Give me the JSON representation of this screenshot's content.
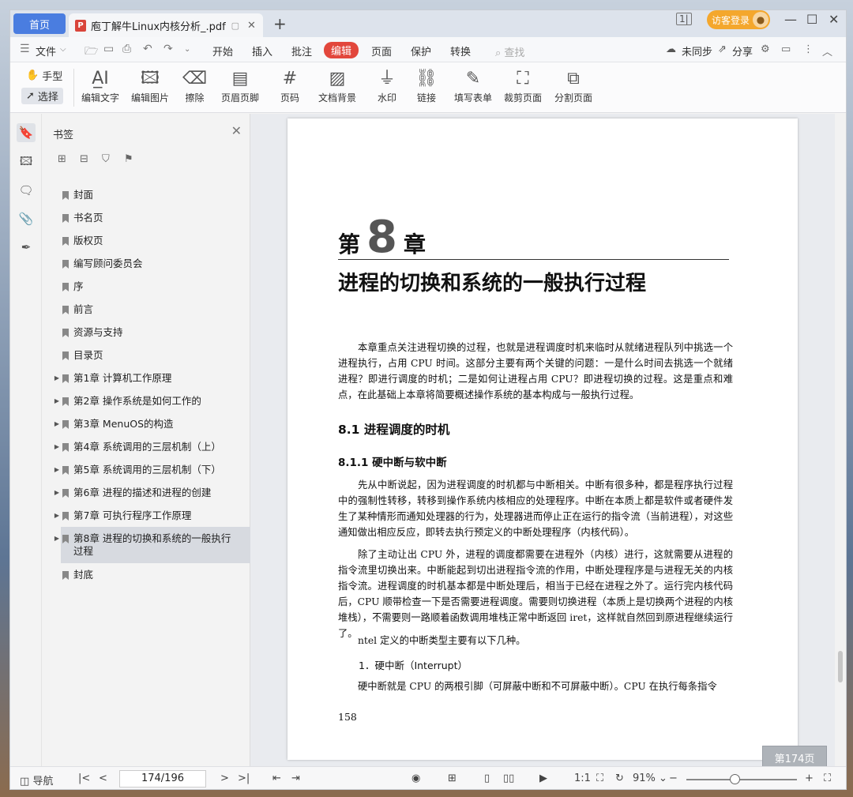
{
  "tabs": {
    "home": "首页",
    "doc_title": "庖丁解牛Linux内核分析_.pdf"
  },
  "header": {
    "visitor_login": "访客登录"
  },
  "menu": {
    "file": "文件",
    "items": [
      "开始",
      "插入",
      "批注",
      "编辑",
      "页面",
      "保护",
      "转换"
    ],
    "search_placeholder": "查找",
    "unsynced": "未同步",
    "share": "分享"
  },
  "ribbon": {
    "hand": "手型",
    "select": "选择",
    "tools": [
      "编辑文字",
      "编辑图片",
      "擦除",
      "页眉页脚",
      "页码",
      "文档背景",
      "水印",
      "链接",
      "填写表单",
      "裁剪页面",
      "分割页面"
    ]
  },
  "bookmarks": {
    "title": "书签",
    "items": [
      {
        "label": "封面",
        "expandable": false
      },
      {
        "label": "书名页",
        "expandable": false
      },
      {
        "label": "版权页",
        "expandable": false
      },
      {
        "label": "编写顾问委员会",
        "expandable": false
      },
      {
        "label": "序",
        "expandable": false
      },
      {
        "label": "前言",
        "expandable": false
      },
      {
        "label": "资源与支持",
        "expandable": false
      },
      {
        "label": "目录页",
        "expandable": false
      },
      {
        "label": "第1章  计算机工作原理",
        "expandable": true
      },
      {
        "label": "第2章  操作系统是如何工作的",
        "expandable": true
      },
      {
        "label": "第3章  MenuOS的构造",
        "expandable": true
      },
      {
        "label": "第4章  系统调用的三层机制（上）",
        "expandable": true
      },
      {
        "label": "第5章  系统调用的三层机制（下）",
        "expandable": true
      },
      {
        "label": "第6章  进程的描述和进程的创建",
        "expandable": true
      },
      {
        "label": "第7章  可执行程序工作原理",
        "expandable": true
      },
      {
        "label": "第8章  进程的切换和系统的一般执行过程",
        "expandable": true,
        "active": true
      },
      {
        "label": "封底",
        "expandable": false
      }
    ]
  },
  "document": {
    "chapter_pre": "第",
    "chapter_num": "8",
    "chapter_post": "章",
    "chapter_title": "进程的切换和系统的一般执行过程",
    "intro": "本章重点关注进程切换的过程，也就是进程调度时机来临时从就绪进程队列中挑选一个进程执行，占用 CPU 时间。这部分主要有两个关键的问题：一是什么时间去挑选一个就绪进程？即进行调度的时机；二是如何让进程占用 CPU？即进程切换的过程。这是重点和难点，在此基础上本章将简要概述操作系统的基本构成与一般执行过程。",
    "h2": "8.1   进程调度的时机",
    "h3": "8.1.1   硬中断与软中断",
    "p1": "先从中断说起，因为进程调度的时机都与中断相关。中断有很多种，都是程序执行过程中的强制性转移，转移到操作系统内核相应的处理程序。中断在本质上都是软件或者硬件发生了某种情形而通知处理器的行为，处理器进而停止正在运行的指令流（当前进程），对这些通知做出相应反应，即转去执行预定义的中断处理程序（内核代码）。",
    "p2": "除了主动让出 CPU 外，进程的调度都需要在进程外（内核）进行，这就需要从进程的指令流里切换出来。中断能起到切出进程指令流的作用，中断处理程序是与进程无关的内核指令流。进程调度的时机基本都是中断处理后，相当于已经在进程之外了。运行完内核代码后，CPU 顺带检查一下是否需要进程调度。需要则切换进程（本质上是切换两个进程的内核堆栈），不需要则一路顺着函数调用堆栈正常中断返回 iret，这样就自然回到原进程继续运行了。",
    "p3": "ntel 定义的中断类型主要有以下几种。",
    "h4": "1．硬中断（Interrupt）",
    "p4": "硬中断就是 CPU 的两根引脚（可屏蔽中断和不可屏蔽中断）。CPU 在执行每条指令",
    "page_number": "158",
    "page_badge": "第174页"
  },
  "status": {
    "nav": "导航",
    "page_indicator": "174/196",
    "zoom": "91%"
  }
}
